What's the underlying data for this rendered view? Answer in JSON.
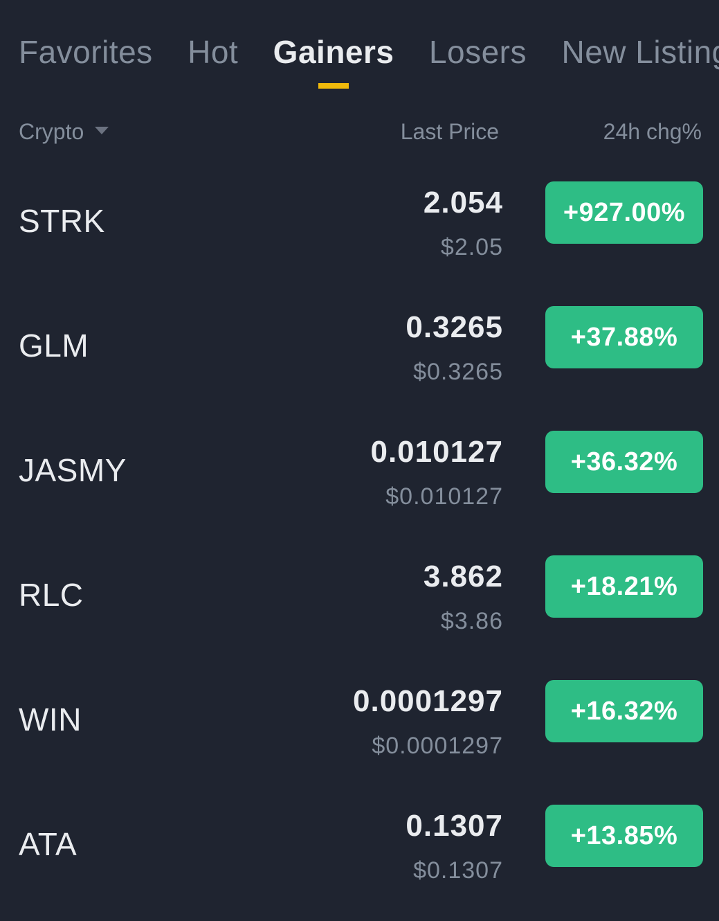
{
  "tabs": [
    {
      "label": "Favorites",
      "active": false
    },
    {
      "label": "Hot",
      "active": false
    },
    {
      "label": "Gainers",
      "active": true
    },
    {
      "label": "Losers",
      "active": false
    },
    {
      "label": "New Listings",
      "active": false
    }
  ],
  "columns": {
    "crypto": "Crypto",
    "last_price": "Last Price",
    "change": "24h chg%"
  },
  "rows": [
    {
      "symbol": "STRK",
      "price": "2.054",
      "usd": "$2.05",
      "change": "+927.00%"
    },
    {
      "symbol": "GLM",
      "price": "0.3265",
      "usd": "$0.3265",
      "change": "+37.88%"
    },
    {
      "symbol": "JASMY",
      "price": "0.010127",
      "usd": "$0.010127",
      "change": "+36.32%"
    },
    {
      "symbol": "RLC",
      "price": "3.862",
      "usd": "$3.86",
      "change": "+18.21%"
    },
    {
      "symbol": "WIN",
      "price": "0.0001297",
      "usd": "$0.0001297",
      "change": "+16.32%"
    },
    {
      "symbol": "ATA",
      "price": "0.1307",
      "usd": "$0.1307",
      "change": "+13.85%"
    }
  ],
  "colors": {
    "background": "#1f2430",
    "accent": "#f0b90b",
    "gain": "#2ebd85",
    "muted": "#848e9c",
    "text": "#eaecef"
  }
}
